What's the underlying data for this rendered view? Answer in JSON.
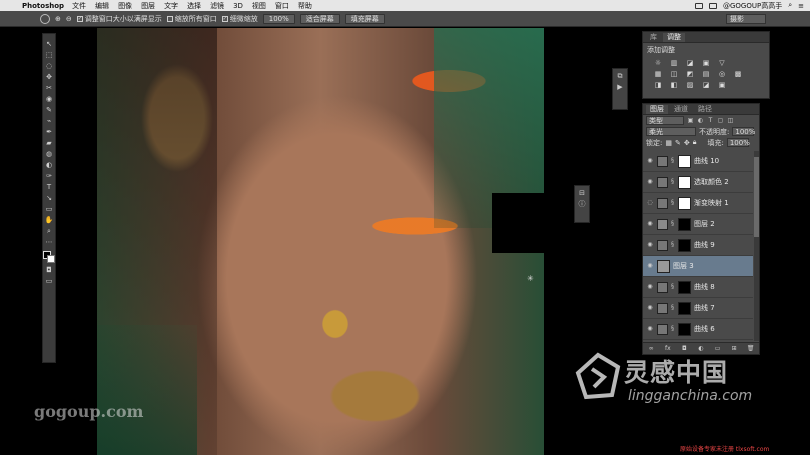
{
  "menubar": {
    "app_name": "Photoshop",
    "items": [
      "文件",
      "编辑",
      "图像",
      "图层",
      "文字",
      "选择",
      "滤镜",
      "3D",
      "视图",
      "窗口",
      "帮助"
    ],
    "user": "@GOGOUP高高手"
  },
  "options": {
    "resize_windows": "调整窗口大小以满屏显示",
    "zoom_all": "缩放所有窗口",
    "scrubby_zoom": "细微缩放",
    "zoom_value": "100%",
    "fit_screen": "适合屏幕",
    "fill_screen": "填充屏幕",
    "workspace": "摄影"
  },
  "tools": [
    "↖",
    "⬚",
    "◌",
    "✥",
    "✂",
    "◉",
    "✎",
    "⌁",
    "✒",
    "▰",
    "◍",
    "◐",
    "✑",
    "T",
    "↘",
    "▭",
    "✋",
    "⌕"
  ],
  "adjustments": {
    "tabs": [
      "库",
      "调整"
    ],
    "active_tab": "调整",
    "title": "添加调整",
    "row1": [
      "☼",
      "▥",
      "◪",
      "▣",
      "▽"
    ],
    "row2": [
      "▦",
      "◫",
      "◩",
      "▤",
      "◎",
      "▩"
    ],
    "row3": [
      "◨",
      "◧",
      "▨",
      "◪",
      "▣"
    ]
  },
  "layers_panel": {
    "tabs": [
      "图层",
      "通道",
      "路径"
    ],
    "active_tab": "图层",
    "filter_kind": "类型",
    "blend_mode": "柔光",
    "opacity_label": "不透明度:",
    "opacity": "100%",
    "lock_label": "锁定:",
    "fill_label": "填充:",
    "fill": "100%",
    "layers": [
      {
        "name": "曲线 10",
        "thumb": "curves",
        "mask": "white",
        "selected": false
      },
      {
        "name": "选取颜色 2",
        "thumb": "selective",
        "mask": "white",
        "selected": false
      },
      {
        "name": "渐变映射 1",
        "thumb": "gradient",
        "mask": "white",
        "selected": false
      },
      {
        "name": "图层 2",
        "thumb": "pixel",
        "mask": "black",
        "selected": false
      },
      {
        "name": "曲线 9",
        "thumb": "curves",
        "mask": "black",
        "selected": false
      },
      {
        "name": "图层 3",
        "thumb": "gray",
        "mask": "",
        "selected": true
      },
      {
        "name": "曲线 8",
        "thumb": "curves",
        "mask": "black",
        "selected": false
      },
      {
        "name": "曲线 7",
        "thumb": "curves",
        "mask": "black",
        "selected": false
      },
      {
        "name": "曲线 6",
        "thumb": "curves",
        "mask": "black",
        "selected": false
      }
    ]
  },
  "watermarks": {
    "left": "gogoup.com",
    "brand_cn": "灵感中国",
    "brand_en": "lingganchina.com",
    "bottom": "原始设备专家未注册 tlxsoft.com"
  }
}
